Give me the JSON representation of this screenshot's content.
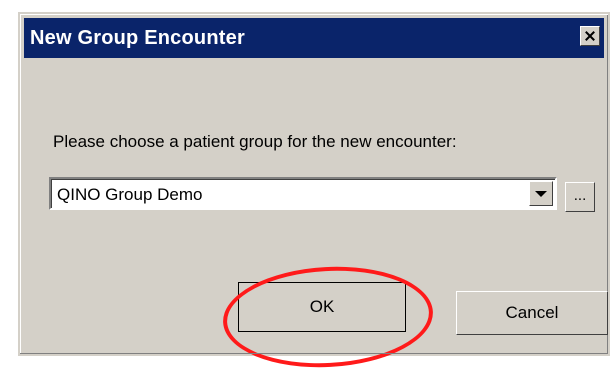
{
  "window": {
    "title": "New Group Encounter",
    "close_icon": "close-icon"
  },
  "prompt": {
    "text": "Please choose a patient group for the new encounter:"
  },
  "patient_group": {
    "selected": "QINO Group Demo",
    "dropdown_icon": "chevron-down-icon",
    "browse_label": "..."
  },
  "actions": {
    "ok_label": "OK",
    "cancel_label": "Cancel"
  },
  "colors": {
    "titlebar": "#0a246a",
    "dialog_background": "#d4d0c8",
    "highlight": "#ff1a1a"
  }
}
